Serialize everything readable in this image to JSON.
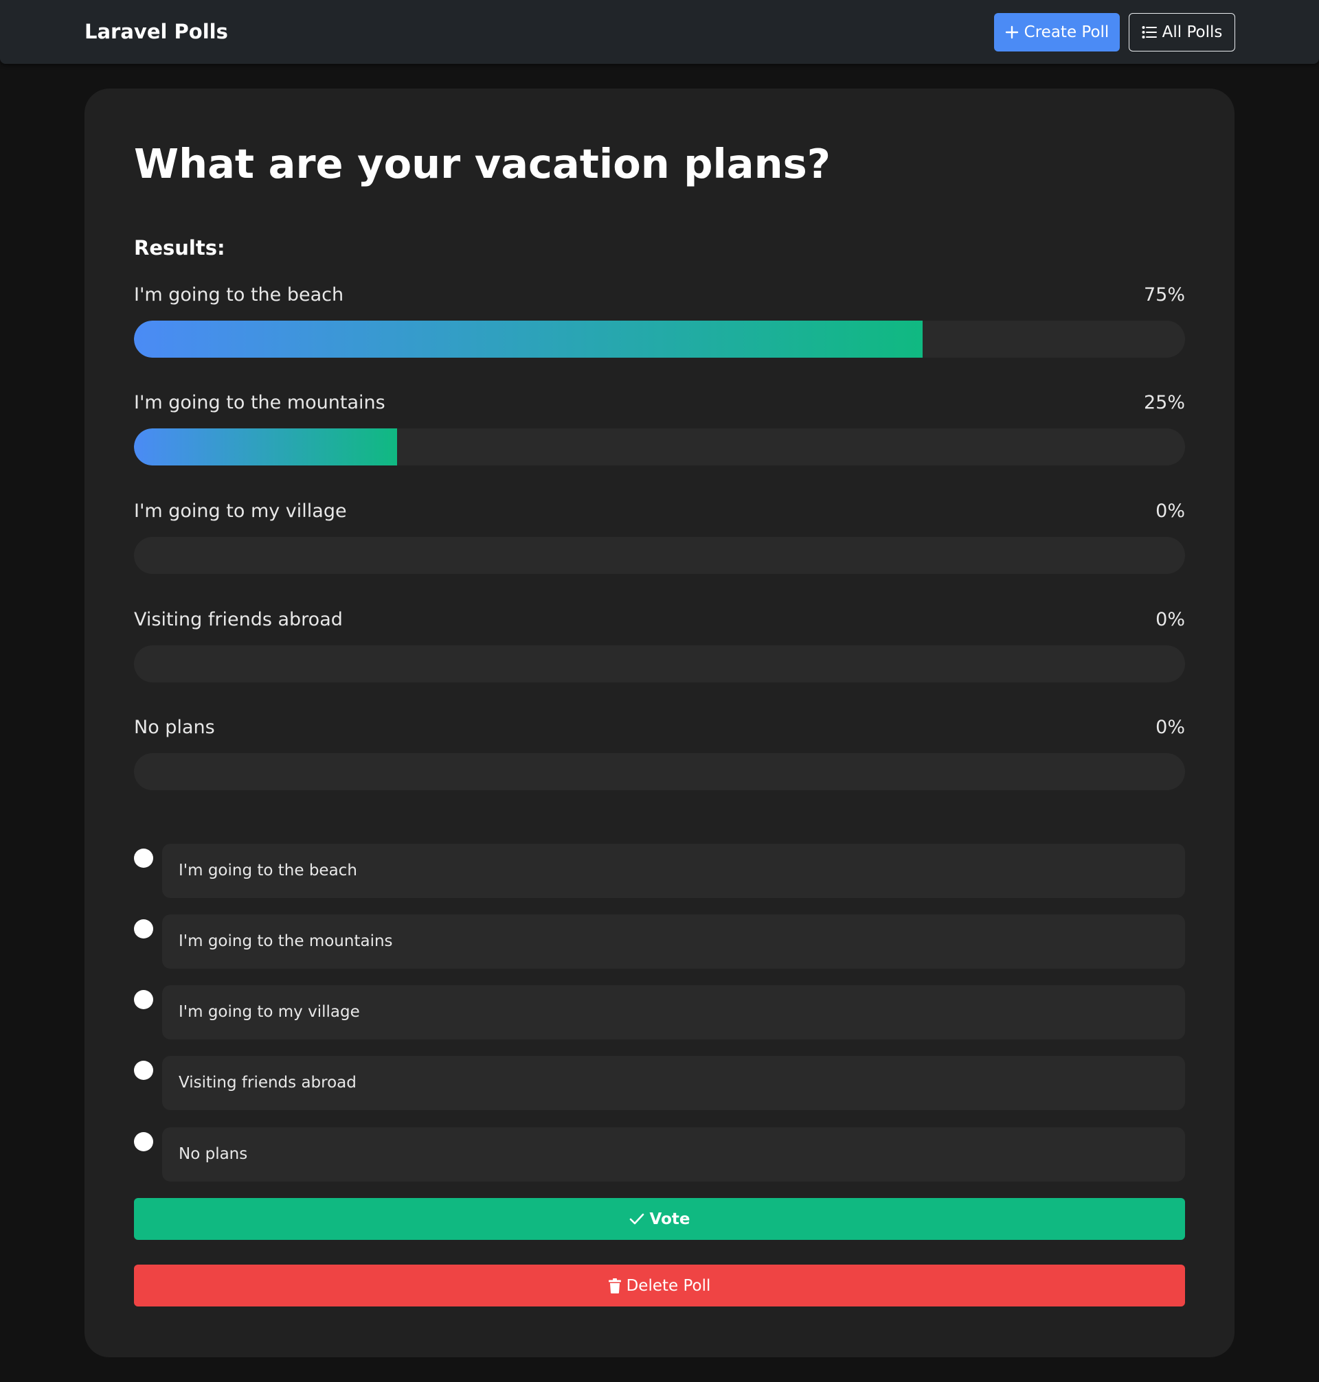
{
  "navbar": {
    "brand": "Laravel Polls",
    "create_label": "Create Poll",
    "all_label": "All Polls",
    "create_icon": "plus-icon",
    "all_icon": "list-icon"
  },
  "poll": {
    "title": "What are your vacation plans?",
    "results_heading": "Results:",
    "results": [
      {
        "label": "I'm going to the beach",
        "percent_text": "75%",
        "percent": 75
      },
      {
        "label": "I'm going to the mountains",
        "percent_text": "25%",
        "percent": 25
      },
      {
        "label": "I'm going to my village",
        "percent_text": "0%",
        "percent": 0
      },
      {
        "label": "Visiting friends abroad",
        "percent_text": "0%",
        "percent": 0
      },
      {
        "label": "No plans",
        "percent_text": "0%",
        "percent": 0
      }
    ],
    "options": [
      {
        "label": "I'm going to the beach"
      },
      {
        "label": "I'm going to the mountains"
      },
      {
        "label": "I'm going to my village"
      },
      {
        "label": "Visiting friends abroad"
      },
      {
        "label": "No plans"
      }
    ],
    "vote_label": "Vote",
    "delete_label": "Delete Poll"
  },
  "colors": {
    "background": "#121212",
    "navbar": "#212529",
    "card": "#212121",
    "primary": "#4b8bf5",
    "success": "#10b981",
    "danger": "#ef4444",
    "track": "#2a2a2a"
  },
  "icons": {
    "vote": "check-icon",
    "delete": "trash-icon"
  }
}
